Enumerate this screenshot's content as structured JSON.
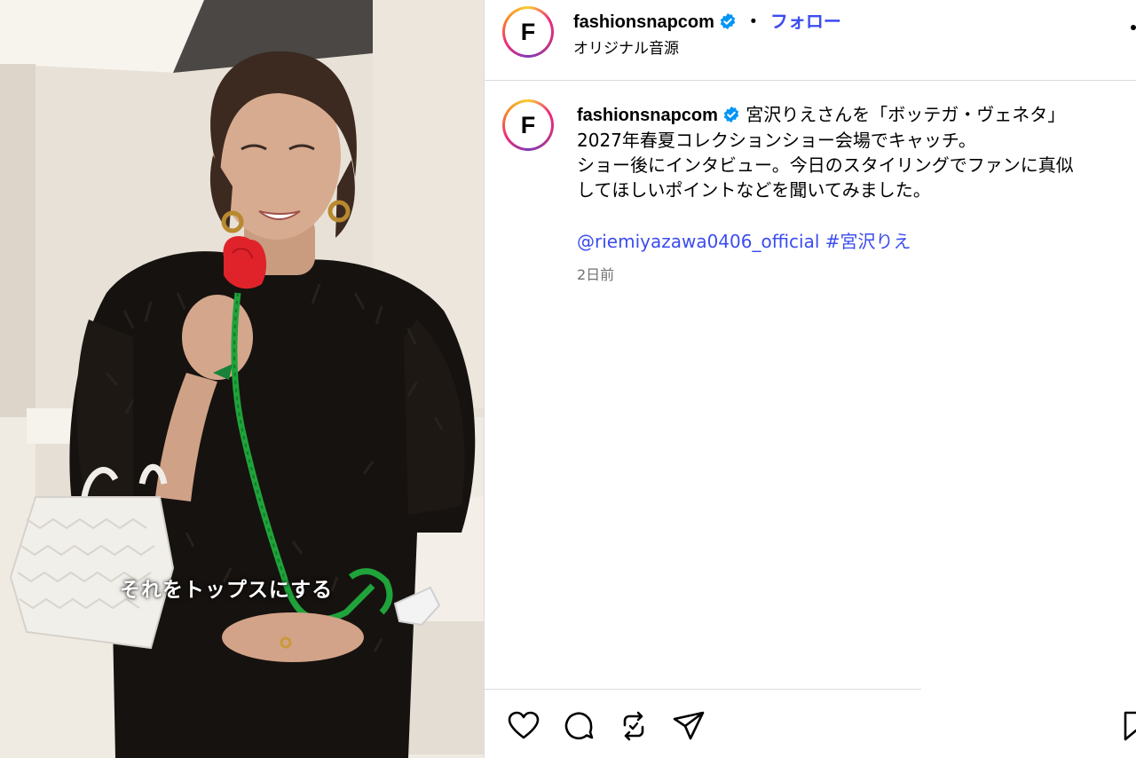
{
  "video": {
    "subtitle": "それをトップスにする"
  },
  "header": {
    "avatar_letter": "F",
    "username": "fashionsnapcom",
    "separator": "・",
    "follow_label": "フォロー",
    "audio_label": "オリジナル音源"
  },
  "caption": {
    "avatar_letter": "F",
    "username": "fashionsnapcom",
    "line1": "宮沢りえさんを「ボッテガ・ヴェネタ」",
    "line2": "2027年春夏コレクションショー会場でキャッチ。",
    "line3": "ショー後にインタビュー。今日のスタイリングでファンに真似",
    "line4": "してほしいポイントなどを聞いてみました。",
    "mention": "@riemiyazawa0406_official",
    "hashtag": "#宮沢りえ",
    "timestamp": "2日前"
  },
  "actions": {
    "icons": [
      "heart-icon",
      "comment-icon",
      "repost-icon",
      "share-icon",
      "bookmark-icon"
    ]
  },
  "colors": {
    "link": "#3b4cf0",
    "verified": "#0095f6",
    "muted": "#737373",
    "divider": "#dbdbdb"
  }
}
